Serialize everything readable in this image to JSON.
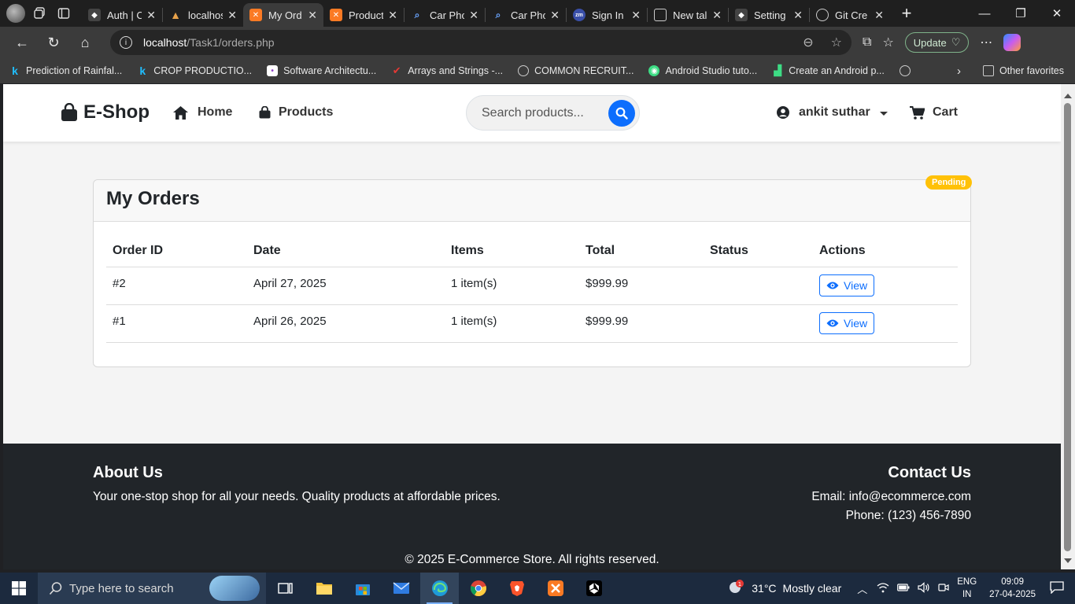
{
  "browser": {
    "tabs": [
      {
        "label": "Auth | C",
        "icon": "unity-icon",
        "active": false
      },
      {
        "label": "localhos",
        "icon": "xampp-tab-icon",
        "active": false
      },
      {
        "label": "My Ord",
        "icon": "xampp-icon",
        "active": true
      },
      {
        "label": "Product",
        "icon": "xampp-icon",
        "active": false
      },
      {
        "label": "Car Pho",
        "icon": "search-icon",
        "active": false
      },
      {
        "label": "Car Pho",
        "icon": "search-icon",
        "active": false
      },
      {
        "label": "Sign In |",
        "icon": "zm-icon",
        "active": false
      },
      {
        "label": "New tal",
        "icon": "newtab-icon",
        "active": false
      },
      {
        "label": "Setting",
        "icon": "unity-icon",
        "active": false
      },
      {
        "label": "Git Cre",
        "icon": "globe-icon",
        "active": false
      }
    ],
    "url_host": "localhost",
    "url_path": "/Task1/orders.php",
    "update_label": "Update",
    "bookmarks": [
      {
        "label": "Prediction of Rainfal...",
        "icon": "k-icon"
      },
      {
        "label": "CROP PRODUCTIO...",
        "icon": "k-icon"
      },
      {
        "label": "Software Architectu...",
        "icon": "page-icon"
      },
      {
        "label": "Arrays and Strings -...",
        "icon": "gfg-icon"
      },
      {
        "label": "COMMON RECRUIT...",
        "icon": "globe-icon"
      },
      {
        "label": "Android Studio tuto...",
        "icon": "android-icon"
      },
      {
        "label": "Create an Android p...",
        "icon": "android-icon"
      }
    ],
    "other_favorites": "Other favorites"
  },
  "site": {
    "brand": "E-Shop",
    "nav_home": "Home",
    "nav_products": "Products",
    "search_placeholder": "Search products...",
    "user_name": "ankit suthar",
    "cart_label": "Cart"
  },
  "orders": {
    "title": "My Orders",
    "badge": "Pending",
    "columns": [
      "Order ID",
      "Date",
      "Items",
      "Total",
      "Status",
      "Actions"
    ],
    "rows": [
      {
        "id": "#2",
        "date": "April 27, 2025",
        "items": "1 item(s)",
        "total": "$999.99",
        "status": "",
        "action": "View"
      },
      {
        "id": "#1",
        "date": "April 26, 2025",
        "items": "1 item(s)",
        "total": "$999.99",
        "status": "",
        "action": "View"
      }
    ]
  },
  "footer": {
    "about_title": "About Us",
    "about_text": "Your one-stop shop for all your needs. Quality products at affordable prices.",
    "contact_title": "Contact Us",
    "email": "Email: info@ecommerce.com",
    "phone": "Phone: (123) 456-7890",
    "copyright": "© 2025 E-Commerce Store. All rights reserved."
  },
  "taskbar": {
    "search_placeholder": "Type here to search",
    "weather_temp": "31°C",
    "weather_desc": "Mostly clear",
    "lang_top": "ENG",
    "lang_bottom": "IN",
    "time": "09:09",
    "date": "27-04-2025"
  }
}
